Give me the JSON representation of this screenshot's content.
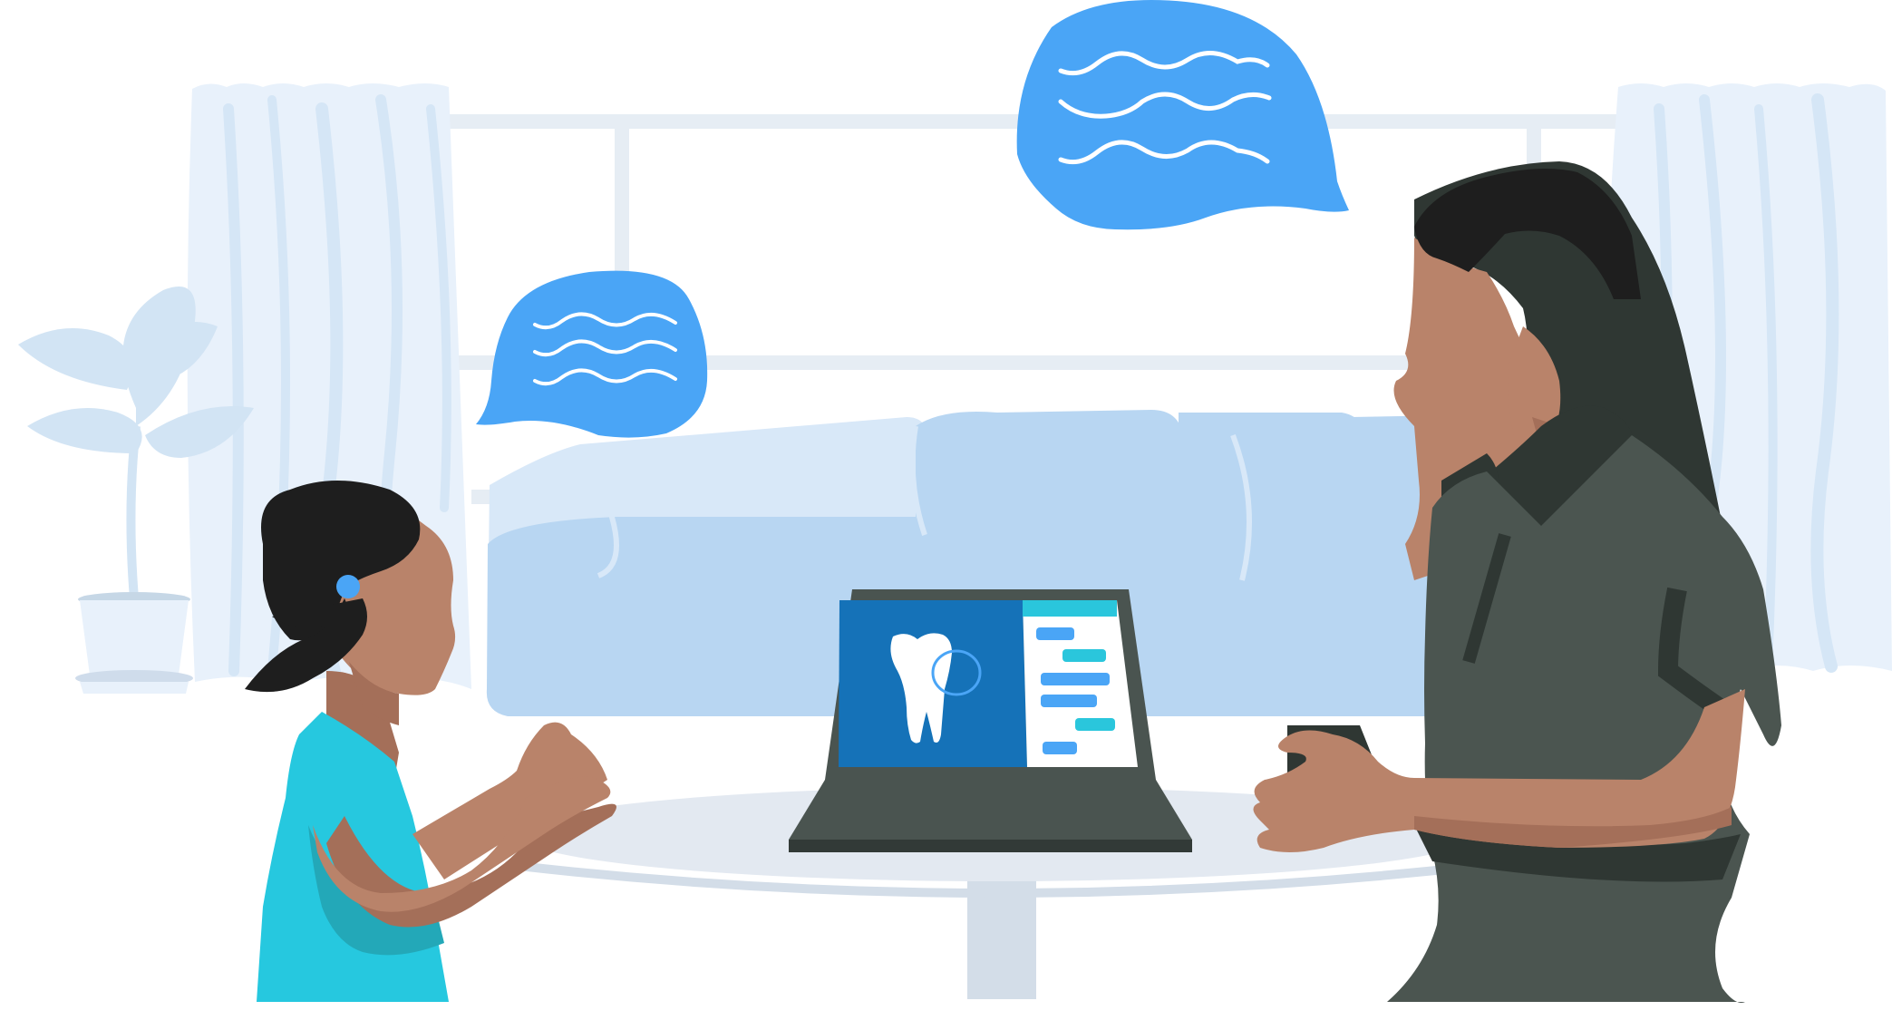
{
  "scene": {
    "description_free": true,
    "colors": {
      "curtain": "#e8f1fb",
      "curtain_fold": "#d5e6f6",
      "window_frame": "#e6edf4",
      "sofa_back": "#b8d6f2",
      "sofa_seat": "#d8e8f8",
      "plant": "#d2e4f4",
      "pot": "#e8f1fb",
      "table_top": "#e3e9f1",
      "table_leg": "#d3dde8",
      "bubble": "#4aa5f6",
      "bubble_wave": "#ffffff",
      "laptop_body": "#4a5450",
      "laptop_base": "#323a37",
      "screen_blue": "#1572b8",
      "screen_panel": "#ffffff",
      "chat_blue": "#4aa5f6",
      "chat_cyan": "#2ac6dc",
      "skin": "#b9836a",
      "skin_shadow": "#a46f59",
      "hair": "#1e1e1e",
      "child_shirt": "#26c8df",
      "child_shirt_shadow": "#23a8b8",
      "hearing_aid": "#4aa5f6",
      "adult_dress": "#4b5550",
      "adult_dress_dark": "#2f3733",
      "phone": "#2f3733"
    },
    "icons": [
      "speech-bubble-icon",
      "tooth-icon",
      "chat-message-icon",
      "hearing-aid-icon",
      "laptop-icon",
      "phone-icon",
      "potted-plant-icon"
    ]
  }
}
